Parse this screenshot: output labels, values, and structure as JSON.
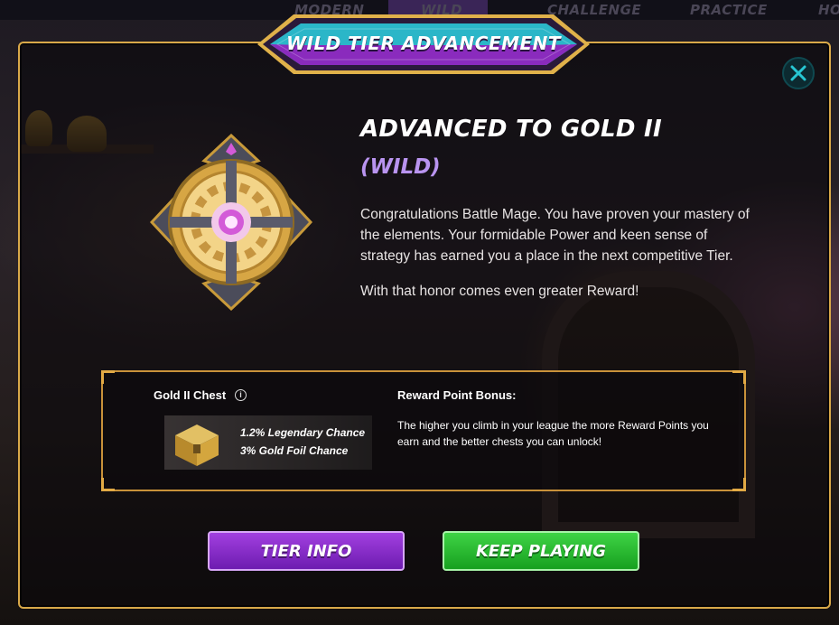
{
  "nav": {
    "tabs": [
      "MODERN",
      "WILD",
      "CHALLENGE",
      "PRACTICE",
      "HO"
    ],
    "active_tab": "WILD"
  },
  "modal": {
    "banner_title": "WILD TIER ADVANCEMENT",
    "title": "ADVANCED TO GOLD II",
    "subtitle": "(WILD)",
    "message_p1": "Congratulations Battle Mage. You have proven your mastery of the elements. Your formidable Power and keen sense of strategy has earned you a place in the next competitive Tier.",
    "message_p2": "With that honor comes even greater Reward!",
    "chest": {
      "label": "Gold II Chest",
      "info_glyph": "i",
      "legendary_chance": "1.2% Legendary Chance",
      "gold_foil_chance": "3% Gold Foil Chance"
    },
    "reward_points": {
      "title": "Reward Point Bonus:",
      "text": "The higher you climb in your league the more Reward Points you earn and the better chests you can unlock!"
    },
    "buttons": {
      "tier_info": "TIER INFO",
      "keep_playing": "KEEP PLAYING"
    }
  },
  "colors": {
    "frame_gold": "#d9a949",
    "subtitle_purple": "#b994f0",
    "tier_button": "#8a2ed0",
    "keep_button": "#2bbd33",
    "close_teal": "#0f4950"
  },
  "icons": [
    "close-icon",
    "tier-badge-icon",
    "chest-icon",
    "info-icon"
  ]
}
